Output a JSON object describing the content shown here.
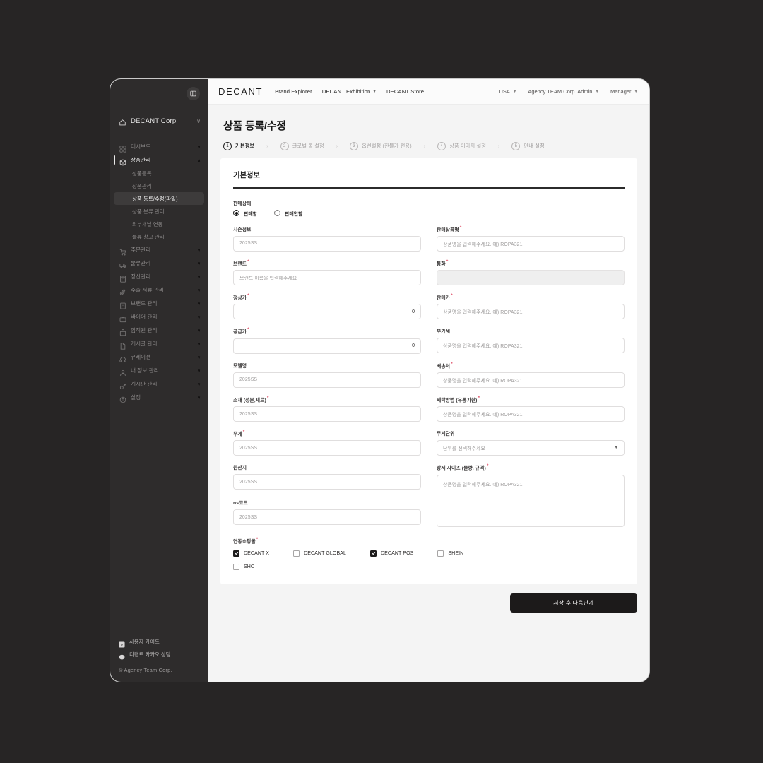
{
  "window": {
    "sidebar": {
      "panel_toggle_icon": "panel-collapse-icon",
      "org": {
        "icon": "home-icon",
        "name": "DECANT Corp",
        "chevron": "∨"
      },
      "nav": [
        {
          "icon": "dashboard-icon",
          "label": "대시보드",
          "chevron": "∨",
          "active": false
        },
        {
          "icon": "box-icon",
          "label": "상품관리",
          "chevron": "∧",
          "active": true,
          "children": [
            {
              "label": "상품등록",
              "active": false
            },
            {
              "label": "상품관리",
              "active": false
            },
            {
              "label": "상품 등록/수정(파일)",
              "active": true
            },
            {
              "label": "상품 분류 관리",
              "active": false
            },
            {
              "label": "외부채널 연동",
              "active": false
            },
            {
              "label": "물류 창고 관리",
              "active": false
            }
          ]
        },
        {
          "icon": "cart-icon",
          "label": "주문관리",
          "chevron": "∨",
          "active": false
        },
        {
          "icon": "truck-icon",
          "label": "물류관리",
          "chevron": "∨",
          "active": false
        },
        {
          "icon": "calculator-icon",
          "label": "정산관리",
          "chevron": "∨",
          "active": false
        },
        {
          "icon": "paperclip-icon",
          "label": "수출 서류 관리",
          "chevron": "∨",
          "active": false
        },
        {
          "icon": "building-icon",
          "label": "브랜드 관리",
          "chevron": "∨",
          "active": false
        },
        {
          "icon": "briefcase-icon",
          "label": "바이어 관리",
          "chevron": "∨",
          "active": false
        },
        {
          "icon": "bag-icon",
          "label": "임직원 관리",
          "chevron": "∨",
          "active": false
        },
        {
          "icon": "document-icon",
          "label": "게시글 관리",
          "chevron": "∨",
          "active": false
        },
        {
          "icon": "headset-icon",
          "label": "큐레이션",
          "chevron": "∨",
          "active": false
        },
        {
          "icon": "user-icon",
          "label": "내 정보 관리",
          "chevron": "∨",
          "active": false
        },
        {
          "icon": "key-icon",
          "label": "계시판 관리",
          "chevron": "∨",
          "active": false
        },
        {
          "icon": "gear-icon",
          "label": "설정",
          "chevron": "∨",
          "active": false
        }
      ],
      "footer": {
        "links": [
          {
            "icon": "pdf-icon",
            "label": "사용자 가이드"
          },
          {
            "icon": "chat-bubble-icon",
            "label": "디캔트 카카오 상담"
          }
        ],
        "copyright": "© Agency Team Corp."
      }
    },
    "topbar": {
      "logo": "DECANT",
      "nav": [
        {
          "label": "Brand Explorer",
          "caret": ""
        },
        {
          "label": "DECANT Exhibition",
          "caret": "▼"
        },
        {
          "label": "DECANT Store",
          "caret": ""
        }
      ],
      "right": [
        {
          "name": "region-select",
          "label": "USA",
          "caret": "▼"
        },
        {
          "name": "account-select",
          "label": "Agency TEAM Corp. Admin",
          "caret": "▼"
        },
        {
          "name": "role-select",
          "label": "Manager",
          "caret": "▼"
        }
      ]
    },
    "page": {
      "title": "상품 등록/수정",
      "steps": [
        {
          "num": "1",
          "label": "기본정보",
          "active": true
        },
        {
          "num": "2",
          "label": "글로벌 몰 설정",
          "active": false
        },
        {
          "num": "3",
          "label": "옵션설정 (한물가 전용)",
          "active": false
        },
        {
          "num": "4",
          "label": "상품 이미지 설정",
          "active": false
        },
        {
          "num": "5",
          "label": "안내 설정",
          "active": false
        }
      ],
      "step_separator": "›",
      "card_title": "기본정보",
      "sale_status": {
        "label": "판매상태",
        "options": [
          {
            "label": "판매함",
            "selected": true
          },
          {
            "label": "판매안함",
            "selected": false
          }
        ]
      },
      "fields": [
        {
          "name": "season-info",
          "label": "시즌정보",
          "required": false,
          "type": "text",
          "placeholder": "2025SS",
          "value": ""
        },
        {
          "name": "sale-product-name",
          "label": "판매상품명",
          "required": true,
          "type": "text",
          "placeholder": "상품명을 입력해주세요. 예) ROPA321",
          "value": ""
        },
        {
          "name": "brand",
          "label": "브랜드",
          "required": true,
          "type": "text",
          "placeholder": "브랜드 이름을 입력해주세요",
          "value": ""
        },
        {
          "name": "currency",
          "label": "통화",
          "required": true,
          "type": "disabled",
          "placeholder": "",
          "value": ""
        },
        {
          "name": "list-price",
          "label": "정상가",
          "required": true,
          "type": "number",
          "placeholder": "",
          "value": "0"
        },
        {
          "name": "sale-price",
          "label": "판매가",
          "required": true,
          "type": "text",
          "placeholder": "상품명을 입력해주세요. 예) ROPA321",
          "value": ""
        },
        {
          "name": "supply-price",
          "label": "공급가",
          "required": true,
          "type": "number",
          "placeholder": "",
          "value": "0"
        },
        {
          "name": "vat",
          "label": "부가세",
          "required": false,
          "type": "text",
          "placeholder": "상품명을 입력해주세요. 예) ROPA321",
          "value": ""
        },
        {
          "name": "model-name",
          "label": "모델명",
          "required": false,
          "type": "text",
          "placeholder": "2025SS",
          "value": ""
        },
        {
          "name": "shipping-origin",
          "label": "배송처",
          "required": true,
          "type": "text",
          "placeholder": "상품명을 입력해주세요. 예) ROPA321",
          "value": ""
        },
        {
          "name": "material",
          "label": "소재 (성분,재료)",
          "required": true,
          "type": "text",
          "placeholder": "2025SS",
          "value": ""
        },
        {
          "name": "washing-method",
          "label": "세탁방법 (유통기한)",
          "required": true,
          "type": "text",
          "placeholder": "상품명을 입력해주세요. 예) ROPA321",
          "value": ""
        },
        {
          "name": "weight",
          "label": "무게",
          "required": true,
          "type": "text",
          "placeholder": "2025SS",
          "value": ""
        },
        {
          "name": "weight-unit",
          "label": "무게단위",
          "required": false,
          "type": "select",
          "placeholder": "단위를 선택해주세요",
          "value": "",
          "caret": "▼"
        },
        {
          "name": "country-of-origin",
          "label": "원산지",
          "required": false,
          "type": "text",
          "placeholder": "2025SS",
          "value": ""
        },
        {
          "name": "detail-size",
          "label": "상세 사이즈 (물량, 규격)",
          "required": true,
          "type": "textarea",
          "placeholder": "상품명을 입력해주세요. 예) ROPA321",
          "value": ""
        },
        {
          "name": "ns-code",
          "label": "ns코드",
          "required": false,
          "type": "text",
          "placeholder": "2025SS",
          "value": ""
        }
      ],
      "linked_malls": {
        "label": "연동쇼핑몰",
        "required": true,
        "options": [
          {
            "label": "DECANT X",
            "checked": true
          },
          {
            "label": "DECANT GLOBAL",
            "checked": false
          },
          {
            "label": "DECANT POS",
            "checked": true
          },
          {
            "label": "SHEIN",
            "checked": false
          },
          {
            "label": "SHC",
            "checked": false
          }
        ]
      },
      "submit_label": "저장 후 다음단계"
    }
  },
  "colors": {
    "page_background": "#272525",
    "sidebar": "#2e2c2c",
    "accent_dark": "#1c1a1a",
    "required_red": "#e0526a",
    "content_bg": "#f4f4f4"
  }
}
